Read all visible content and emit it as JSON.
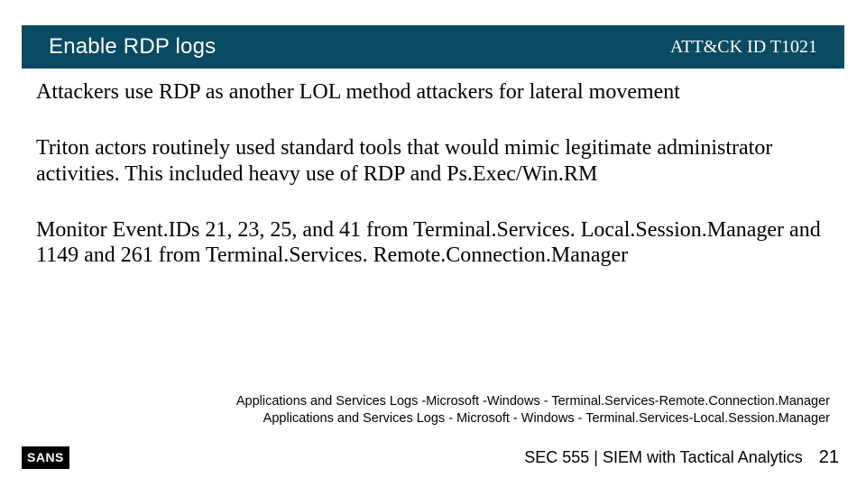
{
  "header": {
    "title": "Enable RDP logs",
    "attck_label": "ATT&CK ID  T1021"
  },
  "body": {
    "p1": "Attackers use RDP as another LOL method attackers for lateral movement",
    "p2": "Triton actors routinely used standard tools that would mimic legitimate administrator activities. This included heavy use of RDP and Ps.Exec/Win.RM",
    "p3": "Monitor Event.IDs 21, 23, 25, and 41 from Terminal.Services. Local.Session.Manager and 1149 and 261 from Terminal.Services. Remote.Connection.Manager"
  },
  "notes": {
    "line1": "Applications and Services Logs -Microsoft -Windows - Terminal.Services-Remote.Connection.Manager",
    "line2": "Applications and Services Logs - Microsoft - Windows - Terminal.Services-Local.Session.Manager"
  },
  "footer": {
    "logo_text": "SANS",
    "course": "SEC 555 | SIEM with Tactical Analytics",
    "page": "21"
  }
}
